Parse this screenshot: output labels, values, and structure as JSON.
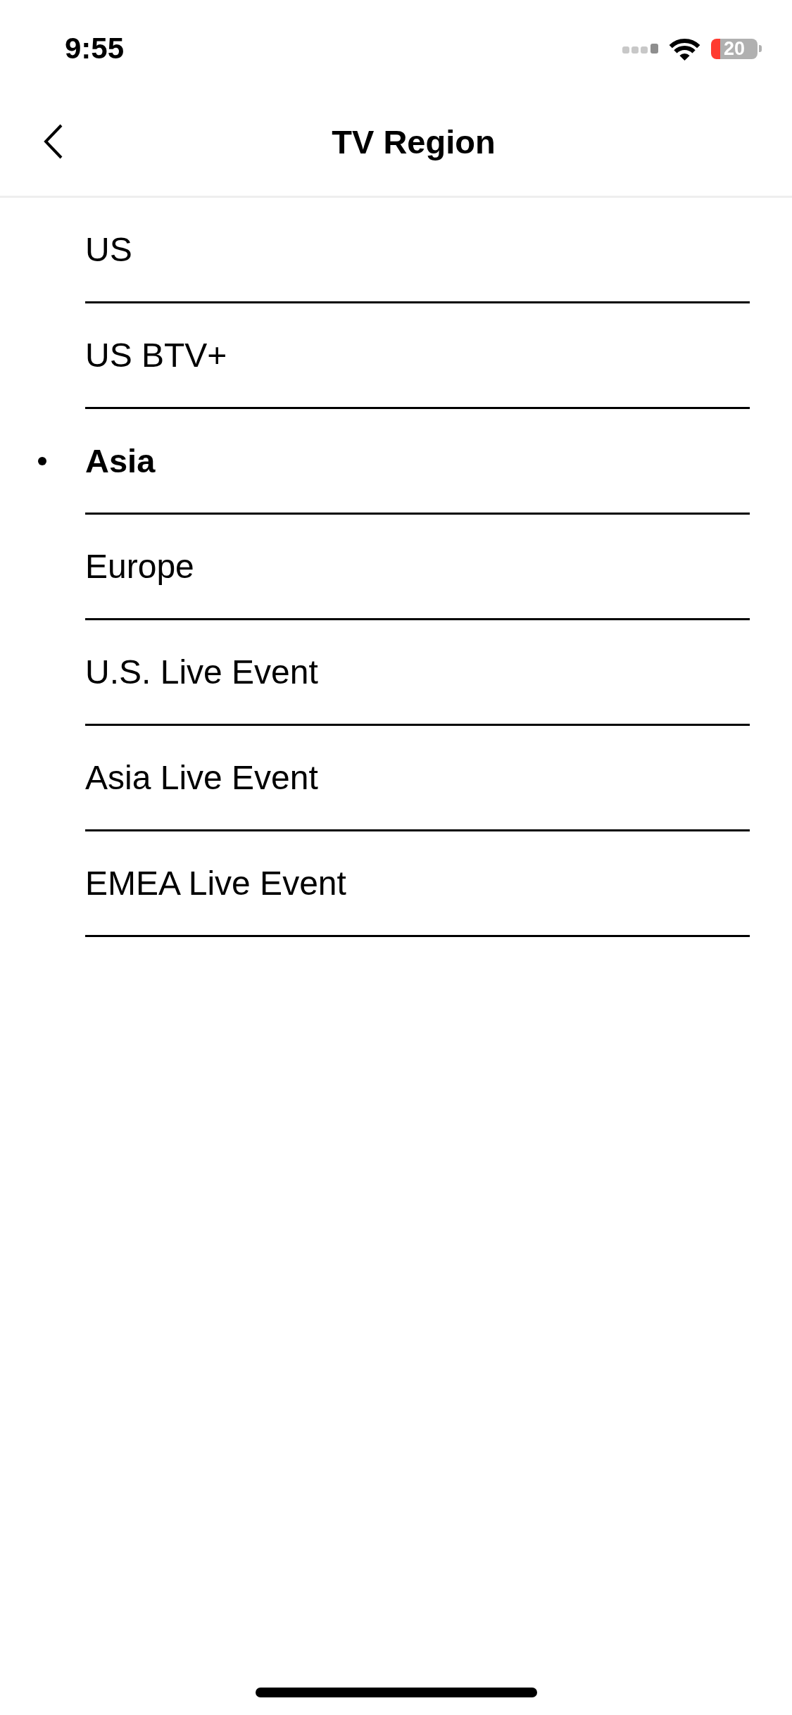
{
  "status_bar": {
    "time": "9:55",
    "battery": "20"
  },
  "header": {
    "title": "TV Region"
  },
  "regions": [
    {
      "label": "US",
      "selected": false
    },
    {
      "label": "US BTV+",
      "selected": false
    },
    {
      "label": "Asia",
      "selected": true
    },
    {
      "label": "Europe",
      "selected": false
    },
    {
      "label": "U.S. Live Event",
      "selected": false
    },
    {
      "label": "Asia Live Event",
      "selected": false
    },
    {
      "label": "EMEA Live Event",
      "selected": false
    }
  ]
}
